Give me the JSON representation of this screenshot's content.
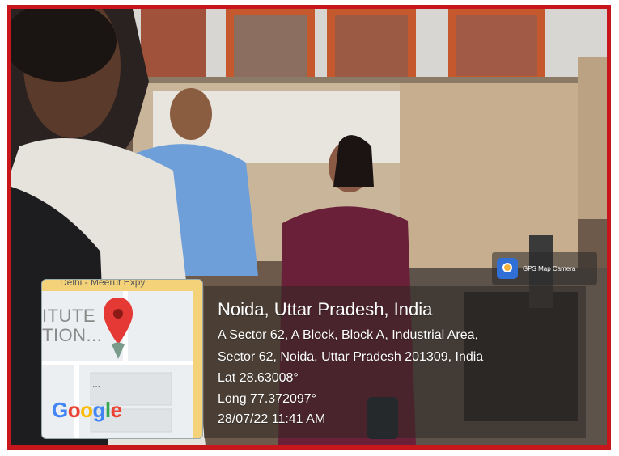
{
  "badge": {
    "label": "GPS Map Camera",
    "logo_icon": "gps-map-camera-icon"
  },
  "map": {
    "road_label": "Delhi - Meerut Expy",
    "poi_line1": "ITUTE",
    "poi_line2": "TION...",
    "dots": "...",
    "pin_icon": "location-pin-icon",
    "google_letters": [
      "G",
      "o",
      "o",
      "g",
      "l",
      "e"
    ]
  },
  "location": {
    "title": "Noida, Uttar Pradesh, India",
    "address_line1": "A Sector 62, A Block, Block A, Industrial Area,",
    "address_line2": "Sector 62, Noida, Uttar Pradesh 201309, India",
    "latitude": "Lat 28.63008°",
    "longitude": "Long 77.372097°",
    "datetime": "28/07/22 11:41 AM"
  },
  "colors": {
    "frame_border": "#c8161d",
    "pin": "#e53935"
  }
}
